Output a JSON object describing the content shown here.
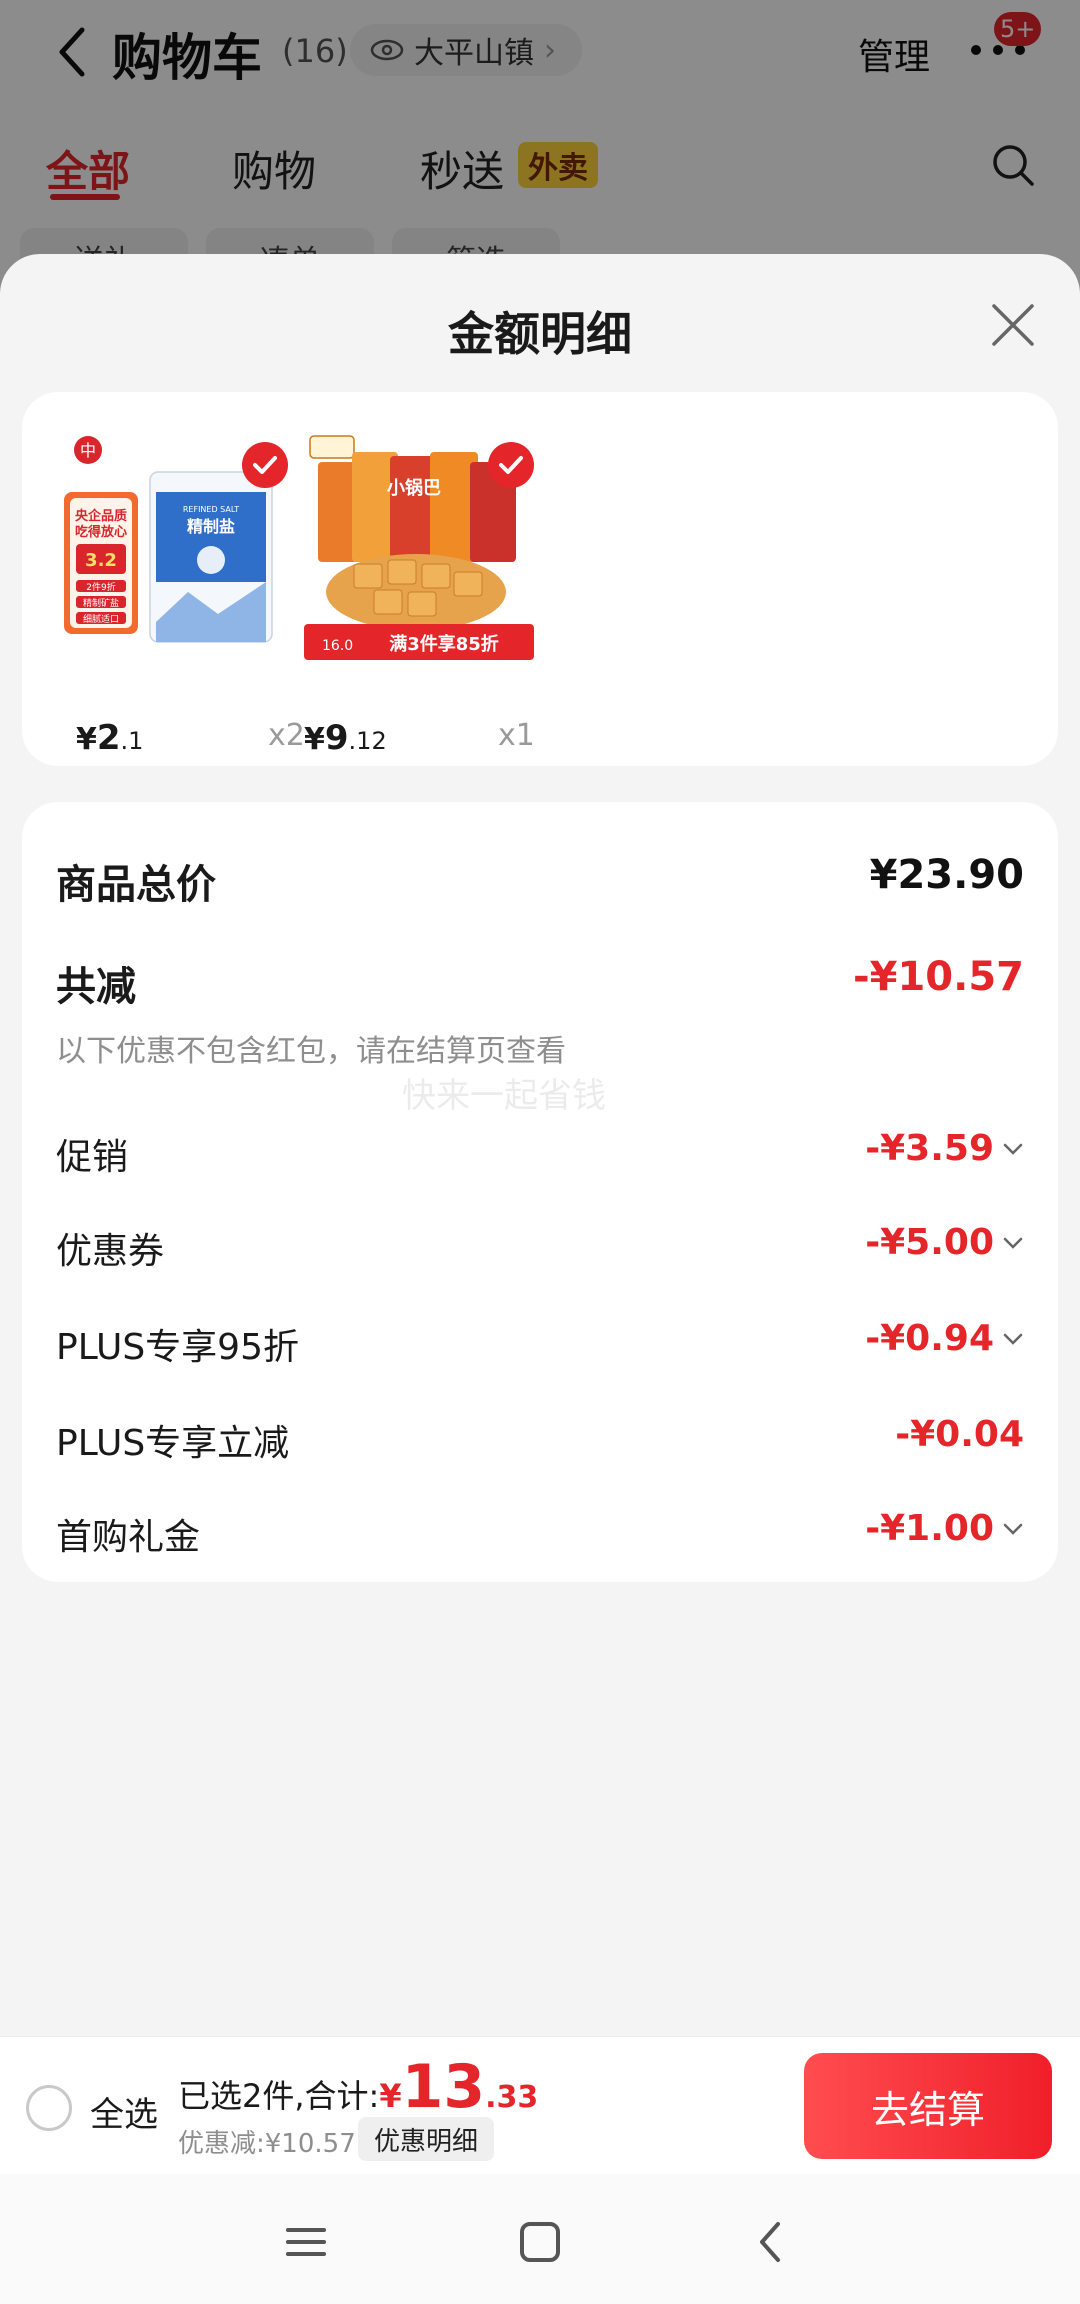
{
  "background": {
    "title": "购物车",
    "count": "(16)",
    "location": "大平山镇",
    "manage": "管理",
    "badge": "5+",
    "tabs": [
      "全部",
      "购物",
      "秒送"
    ],
    "waimai": "外卖",
    "chips": [
      "送礼",
      "凑单",
      "筛选"
    ]
  },
  "sheet": {
    "title": "金额明细"
  },
  "products": [
    {
      "name": "中盐 精制盐",
      "price_int": "2",
      "price_cents": ".1",
      "qty": "x2",
      "selected": true
    },
    {
      "name": "小锅巴",
      "price_int": "9",
      "price_cents": ".12",
      "qty": "x1",
      "selected": true
    }
  ],
  "product_art": {
    "salt_promo_lines": [
      "央企品质",
      "吃得放心"
    ],
    "salt_promo_price": "3.2",
    "salt_promo_sub": [
      "2件9折",
      "精制矿盐",
      "细腻适口"
    ],
    "salt_bag_label": "精制盐",
    "salt_bag_en": "REFINED SALT",
    "snack_banner": "满3件享85折",
    "snack_banner_price": "16.0",
    "snack_brand": "小锅巴"
  },
  "details": {
    "total_label": "商品总价",
    "total_value": "¥23.90",
    "reduce_label": "共减",
    "reduce_value": "-¥10.57",
    "note": "以下优惠不包含红包，请在结算页查看",
    "watermark": "快来一起省钱",
    "items": [
      {
        "label": "促销",
        "value": "-¥3.59",
        "expandable": true
      },
      {
        "label": "优惠券",
        "value": "-¥5.00",
        "expandable": true
      },
      {
        "label": "PLUS专享95折",
        "value": "-¥0.94",
        "expandable": true
      },
      {
        "label": "PLUS专享立减",
        "value": "-¥0.04",
        "expandable": false
      },
      {
        "label": "首购礼金",
        "value": "-¥1.00",
        "expandable": true
      }
    ]
  },
  "bottom": {
    "select_all": "全选",
    "selected_text": "已选2件,合计:",
    "yen": "¥",
    "total_int": "13",
    "total_dec": ".33",
    "saved_text": "优惠减:¥10.57",
    "detail_chip": "优惠明细",
    "checkout": "去结算"
  },
  "colors": {
    "accent": "#e4262b",
    "background": "#f4f4f4"
  }
}
